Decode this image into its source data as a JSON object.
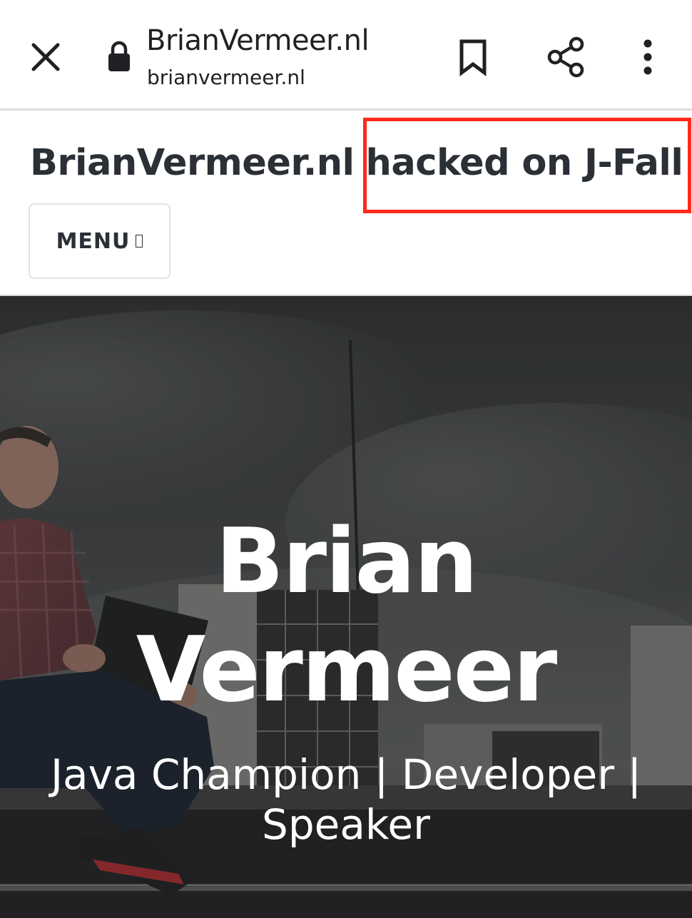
{
  "browser": {
    "title": "BrianVermeer.nl",
    "url": "brianvermeer.nl",
    "icons": {
      "close": "close-icon",
      "lock": "lock-icon",
      "bookmark": "bookmark-icon",
      "share": "share-icon",
      "more": "more-vert-icon"
    }
  },
  "site": {
    "title_main": "BrianVermeer.nl",
    "title_highlight": "hacked on J-Fall",
    "menu_label": "MENU",
    "highlight_color": "#ff2a1a"
  },
  "hero": {
    "name_line1": "Brian",
    "name_line2": "Vermeer",
    "tagline": "Java Champion | Developer | Speaker"
  }
}
